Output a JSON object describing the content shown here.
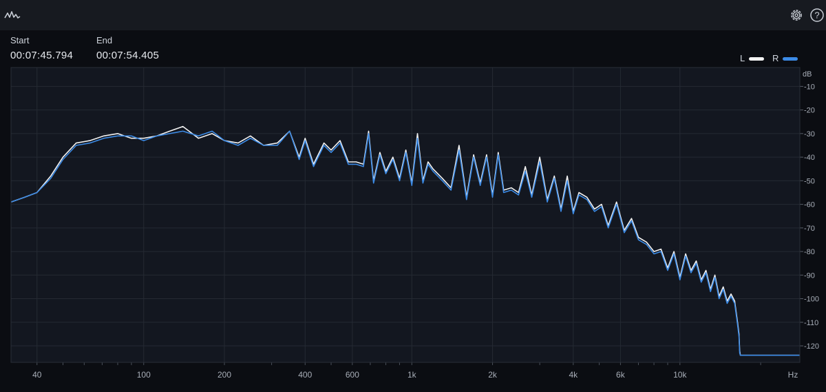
{
  "header": {
    "app_icon": "spectrum-wave-icon",
    "settings_icon": "gear-icon",
    "help_icon": "help-circle-icon"
  },
  "selection": {
    "start_label": "Start",
    "start_value": "00:07:45.794",
    "end_label": "End",
    "end_value": "00:07:54.405"
  },
  "legend": [
    {
      "label": "L",
      "color": "#f2f2f2"
    },
    {
      "label": "R",
      "color": "#3c8be6"
    }
  ],
  "colors": {
    "plot_bg": "#131720",
    "grid": "#252a33",
    "axis_text": "#a8aeb8"
  },
  "chart_data": {
    "type": "line",
    "xscale": "log",
    "xlim": [
      32,
      28000
    ],
    "ylim": [
      -127,
      -2
    ],
    "x_ticks": [
      {
        "value": 40,
        "label": "40"
      },
      {
        "value": 100,
        "label": "100"
      },
      {
        "value": 200,
        "label": "200"
      },
      {
        "value": 400,
        "label": "400"
      },
      {
        "value": 600,
        "label": "600"
      },
      {
        "value": 1000,
        "label": "1k"
      },
      {
        "value": 2000,
        "label": "2k"
      },
      {
        "value": 4000,
        "label": "4k"
      },
      {
        "value": 6000,
        "label": "6k"
      },
      {
        "value": 10000,
        "label": "10k"
      }
    ],
    "x_unit": "Hz",
    "y_unit": "dB",
    "y_ticks": [
      -10,
      -20,
      -30,
      -40,
      -50,
      -60,
      -70,
      -80,
      -90,
      -100,
      -110,
      -120
    ],
    "series": [
      {
        "name": "L",
        "x": [
          32,
          36,
          40,
          45,
          50,
          56,
          63,
          71,
          80,
          90,
          100,
          112,
          125,
          140,
          160,
          180,
          200,
          225,
          250,
          280,
          315,
          350,
          380,
          400,
          430,
          470,
          500,
          540,
          580,
          620,
          660,
          690,
          720,
          760,
          800,
          850,
          900,
          950,
          1000,
          1050,
          1100,
          1150,
          1200,
          1300,
          1400,
          1500,
          1600,
          1700,
          1800,
          1900,
          2000,
          2100,
          2200,
          2350,
          2500,
          2650,
          2800,
          3000,
          3200,
          3400,
          3600,
          3800,
          4000,
          4200,
          4500,
          4800,
          5100,
          5400,
          5800,
          6200,
          6600,
          7000,
          7500,
          8000,
          8500,
          9000,
          9500,
          10000,
          10500,
          11000,
          11500,
          12000,
          12500,
          13000,
          13500,
          14000,
          14500,
          15000,
          15500,
          16000,
          16400,
          16600,
          16700,
          16800,
          17000,
          18000,
          20000,
          22000,
          24000,
          26000,
          28000
        ],
        "y": [
          -59,
          -57,
          -55,
          -48,
          -40,
          -34,
          -33,
          -31,
          -30,
          -32,
          -32,
          -31,
          -29,
          -27,
          -32,
          -30,
          -33,
          -34,
          -31,
          -35,
          -34,
          -29,
          -40,
          -32,
          -43,
          -34,
          -37,
          -33,
          -42,
          -42,
          -43,
          -29,
          -50,
          -38,
          -46,
          -40,
          -49,
          -37,
          -51,
          -30,
          -50,
          -42,
          -45,
          -49,
          -53,
          -35,
          -57,
          -39,
          -51,
          -39,
          -56,
          -38,
          -54,
          -53,
          -55,
          -44,
          -56,
          -40,
          -58,
          -48,
          -62,
          -48,
          -63,
          -55,
          -57,
          -62,
          -60,
          -69,
          -59,
          -71,
          -66,
          -74,
          -76,
          -80,
          -79,
          -87,
          -80,
          -91,
          -81,
          -88,
          -84,
          -92,
          -88,
          -96,
          -90,
          -99,
          -95,
          -101,
          -98,
          -101,
          -110,
          -115,
          -122,
          -124,
          -124,
          -124,
          -124,
          -124,
          -124,
          -124,
          -124
        ]
      },
      {
        "name": "R",
        "x": [
          32,
          36,
          40,
          45,
          50,
          56,
          63,
          71,
          80,
          90,
          100,
          112,
          125,
          140,
          160,
          180,
          200,
          225,
          250,
          280,
          315,
          350,
          380,
          400,
          430,
          470,
          500,
          540,
          580,
          620,
          660,
          690,
          720,
          760,
          800,
          850,
          900,
          950,
          1000,
          1050,
          1100,
          1150,
          1200,
          1300,
          1400,
          1500,
          1600,
          1700,
          1800,
          1900,
          2000,
          2100,
          2200,
          2350,
          2500,
          2650,
          2800,
          3000,
          3200,
          3400,
          3600,
          3800,
          4000,
          4200,
          4500,
          4800,
          5100,
          5400,
          5800,
          6200,
          6600,
          7000,
          7500,
          8000,
          8500,
          9000,
          9500,
          10000,
          10500,
          11000,
          11500,
          12000,
          12500,
          13000,
          13500,
          14000,
          14500,
          15000,
          15500,
          16000,
          16400,
          16600,
          16700,
          16800,
          17000,
          18000,
          20000,
          22000,
          24000,
          26000,
          28000
        ],
        "y": [
          -59,
          -57,
          -55,
          -49,
          -41,
          -35,
          -34,
          -32,
          -31,
          -31,
          -33,
          -31,
          -30,
          -29,
          -31,
          -29,
          -33,
          -35,
          -32,
          -35,
          -35,
          -29,
          -41,
          -33,
          -44,
          -35,
          -38,
          -34,
          -43,
          -43,
          -44,
          -30,
          -51,
          -39,
          -47,
          -41,
          -50,
          -38,
          -52,
          -32,
          -51,
          -43,
          -46,
          -50,
          -54,
          -37,
          -58,
          -40,
          -52,
          -40,
          -57,
          -39,
          -55,
          -54,
          -56,
          -46,
          -57,
          -42,
          -59,
          -49,
          -63,
          -50,
          -64,
          -56,
          -58,
          -63,
          -61,
          -70,
          -60,
          -72,
          -67,
          -75,
          -77,
          -81,
          -80,
          -88,
          -81,
          -92,
          -82,
          -89,
          -85,
          -93,
          -89,
          -97,
          -91,
          -100,
          -96,
          -102,
          -99,
          -102,
          -111,
          -116,
          -123,
          -124,
          -124,
          -124,
          -124,
          -124,
          -124,
          -124,
          -124
        ]
      }
    ]
  }
}
